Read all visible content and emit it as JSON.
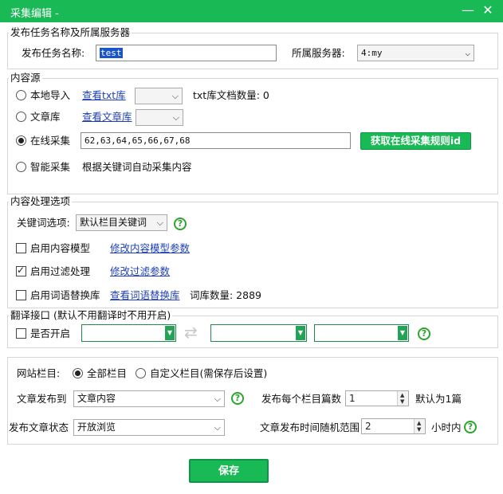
{
  "window": {
    "title": "采集编辑 -",
    "minimize_glyph": "—",
    "close_glyph": "✕"
  },
  "publish": {
    "group_title": "发布任务名称及所属服务器",
    "name_label": "发布任务名称:",
    "name_value": "test",
    "server_label": "所属服务器:",
    "server_value": "4:my"
  },
  "source": {
    "group_title": "内容源",
    "local_label": "本地导入",
    "local_link": "查看txt库",
    "txt_count_label": "txt库文档数量: 0",
    "article_label": "文章库",
    "article_link": "查看文章库",
    "online_label": "在线采集",
    "online_value": "62,63,64,65,66,67,68",
    "online_button": "获取在线采集规则id",
    "smart_label": "智能采集",
    "smart_desc": "根据关键词自动采集内容",
    "selected": "online"
  },
  "processing": {
    "group_title": "内容处理选项",
    "keyword_label": "关键词选项:",
    "keyword_value": "默认栏目关键词",
    "model_label": "启用内容模型",
    "model_link": "修改内容模型参数",
    "model_checked": false,
    "filter_label": "启用过滤处理",
    "filter_link": "修改过滤参数",
    "filter_checked": true,
    "replace_label": "启用词语替换库",
    "replace_link": "查看词语替换库",
    "replace_count": "词库数量: 2889",
    "replace_checked": false
  },
  "translate": {
    "group_title": "翻译接口 (默认不用翻译时不用开启)",
    "enable_label": "是否开启",
    "swap_icon": "⇄"
  },
  "site": {
    "column_label": "网站栏目:",
    "all_label": "全部栏目",
    "custom_label": "自定义栏目(需保存后设置)",
    "publish_to_label": "文章发布到",
    "publish_to_value": "文章内容",
    "per_column_label": "发布每个栏目篇数",
    "per_column_value": "1",
    "per_column_hint": "默认为1篇",
    "status_label": "发布文章状态",
    "status_value": "开放浏览",
    "random_label": "文章发布时间随机范围",
    "random_value": "2",
    "random_unit": "小时内"
  },
  "save_label": "保存",
  "colors": {
    "accent": "#19b955",
    "link": "#1d3fb8",
    "help": "#2da42d"
  }
}
